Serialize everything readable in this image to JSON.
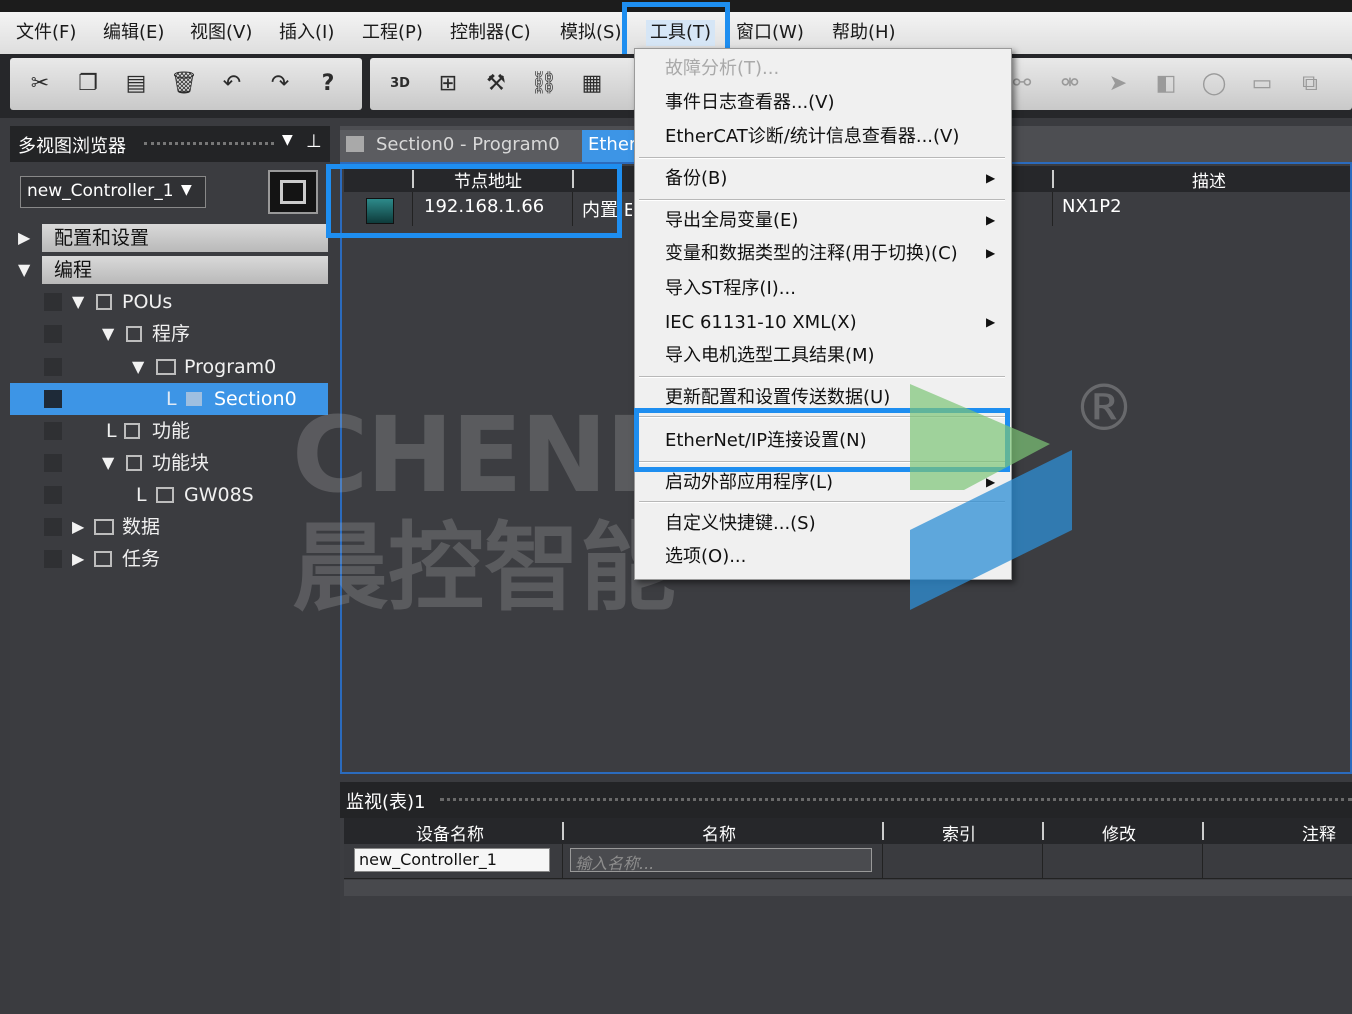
{
  "menubar": {
    "items": [
      {
        "label": "文件(F)"
      },
      {
        "label": "编辑(E)"
      },
      {
        "label": "视图(V)"
      },
      {
        "label": "插入(I)"
      },
      {
        "label": "工程(P)"
      },
      {
        "label": "控制器(C)"
      },
      {
        "label": "模拟(S)"
      },
      {
        "label": "工具(T)"
      },
      {
        "label": "窗口(W)"
      },
      {
        "label": "帮助(H)"
      }
    ]
  },
  "toolbar": {
    "buttons": [
      "cut-icon",
      "copy-icon",
      "paste-icon",
      "delete-icon",
      "undo-icon",
      "redo-icon",
      "help-icon",
      "3d-icon",
      "layout-icon",
      "build-icon",
      "network-icon",
      "io-icon"
    ],
    "icon_3d": "3D"
  },
  "left_panel": {
    "title": "多视图浏览器",
    "pin": "⊥",
    "controller_select": "new_Controller_1",
    "tree": [
      {
        "label": "配置和设置"
      },
      {
        "label": "编程"
      },
      {
        "label": "POUs"
      },
      {
        "label": "程序"
      },
      {
        "label": "Program0"
      },
      {
        "label": "Section0"
      },
      {
        "label": "功能"
      },
      {
        "label": "功能块"
      },
      {
        "label": "GW08S"
      },
      {
        "label": "数据"
      },
      {
        "label": "任务"
      }
    ]
  },
  "editor": {
    "tabs": [
      {
        "label": "Section0 - Program0"
      },
      {
        "label": "Ether"
      }
    ],
    "table": {
      "headers": [
        "节点地址",
        "描述"
      ],
      "row": {
        "address": "192.168.1.66",
        "type": "内置 E",
        "description": "NX1P2"
      }
    }
  },
  "tools_menu": {
    "items": [
      {
        "label": "故障分析(T)...",
        "disabled": true
      },
      {
        "label": "事件日志查看器...(V)"
      },
      {
        "label": "EtherCAT诊断/统计信息查看器...(V)"
      },
      {
        "label": "备份(B)",
        "submenu": true
      },
      {
        "label": "导出全局变量(E)",
        "submenu": true
      },
      {
        "label": "变量和数据类型的注释(用于切换)(C)",
        "submenu": true
      },
      {
        "label": "导入ST程序(I)..."
      },
      {
        "label": "IEC 61131-10 XML(X)",
        "submenu": true
      },
      {
        "label": "导入电机选型工具结果(M)"
      },
      {
        "label": "更新配置和设置传送数据(U)"
      },
      {
        "label": "EtherNet/IP连接设置(N)"
      },
      {
        "label": "启动外部应用程序(L)",
        "submenu": true
      },
      {
        "label": "自定义快捷键...(S)"
      },
      {
        "label": "选项(O)..."
      }
    ]
  },
  "monitor": {
    "title": "监视(表)1",
    "headers": [
      "设备名称",
      "名称",
      "索引",
      "修改",
      "注释"
    ],
    "device_value": "new_Controller_1",
    "name_placeholder": "输入名称..."
  },
  "watermark": {
    "text_en": "CHENKONG",
    "text_cn": "晨控智能",
    "reg": "®"
  },
  "colors": {
    "highlight": "#1e8ef0",
    "selection": "#3d95e6",
    "logo_green": "#7cc576",
    "logo_blue": "#2e8fd6"
  }
}
